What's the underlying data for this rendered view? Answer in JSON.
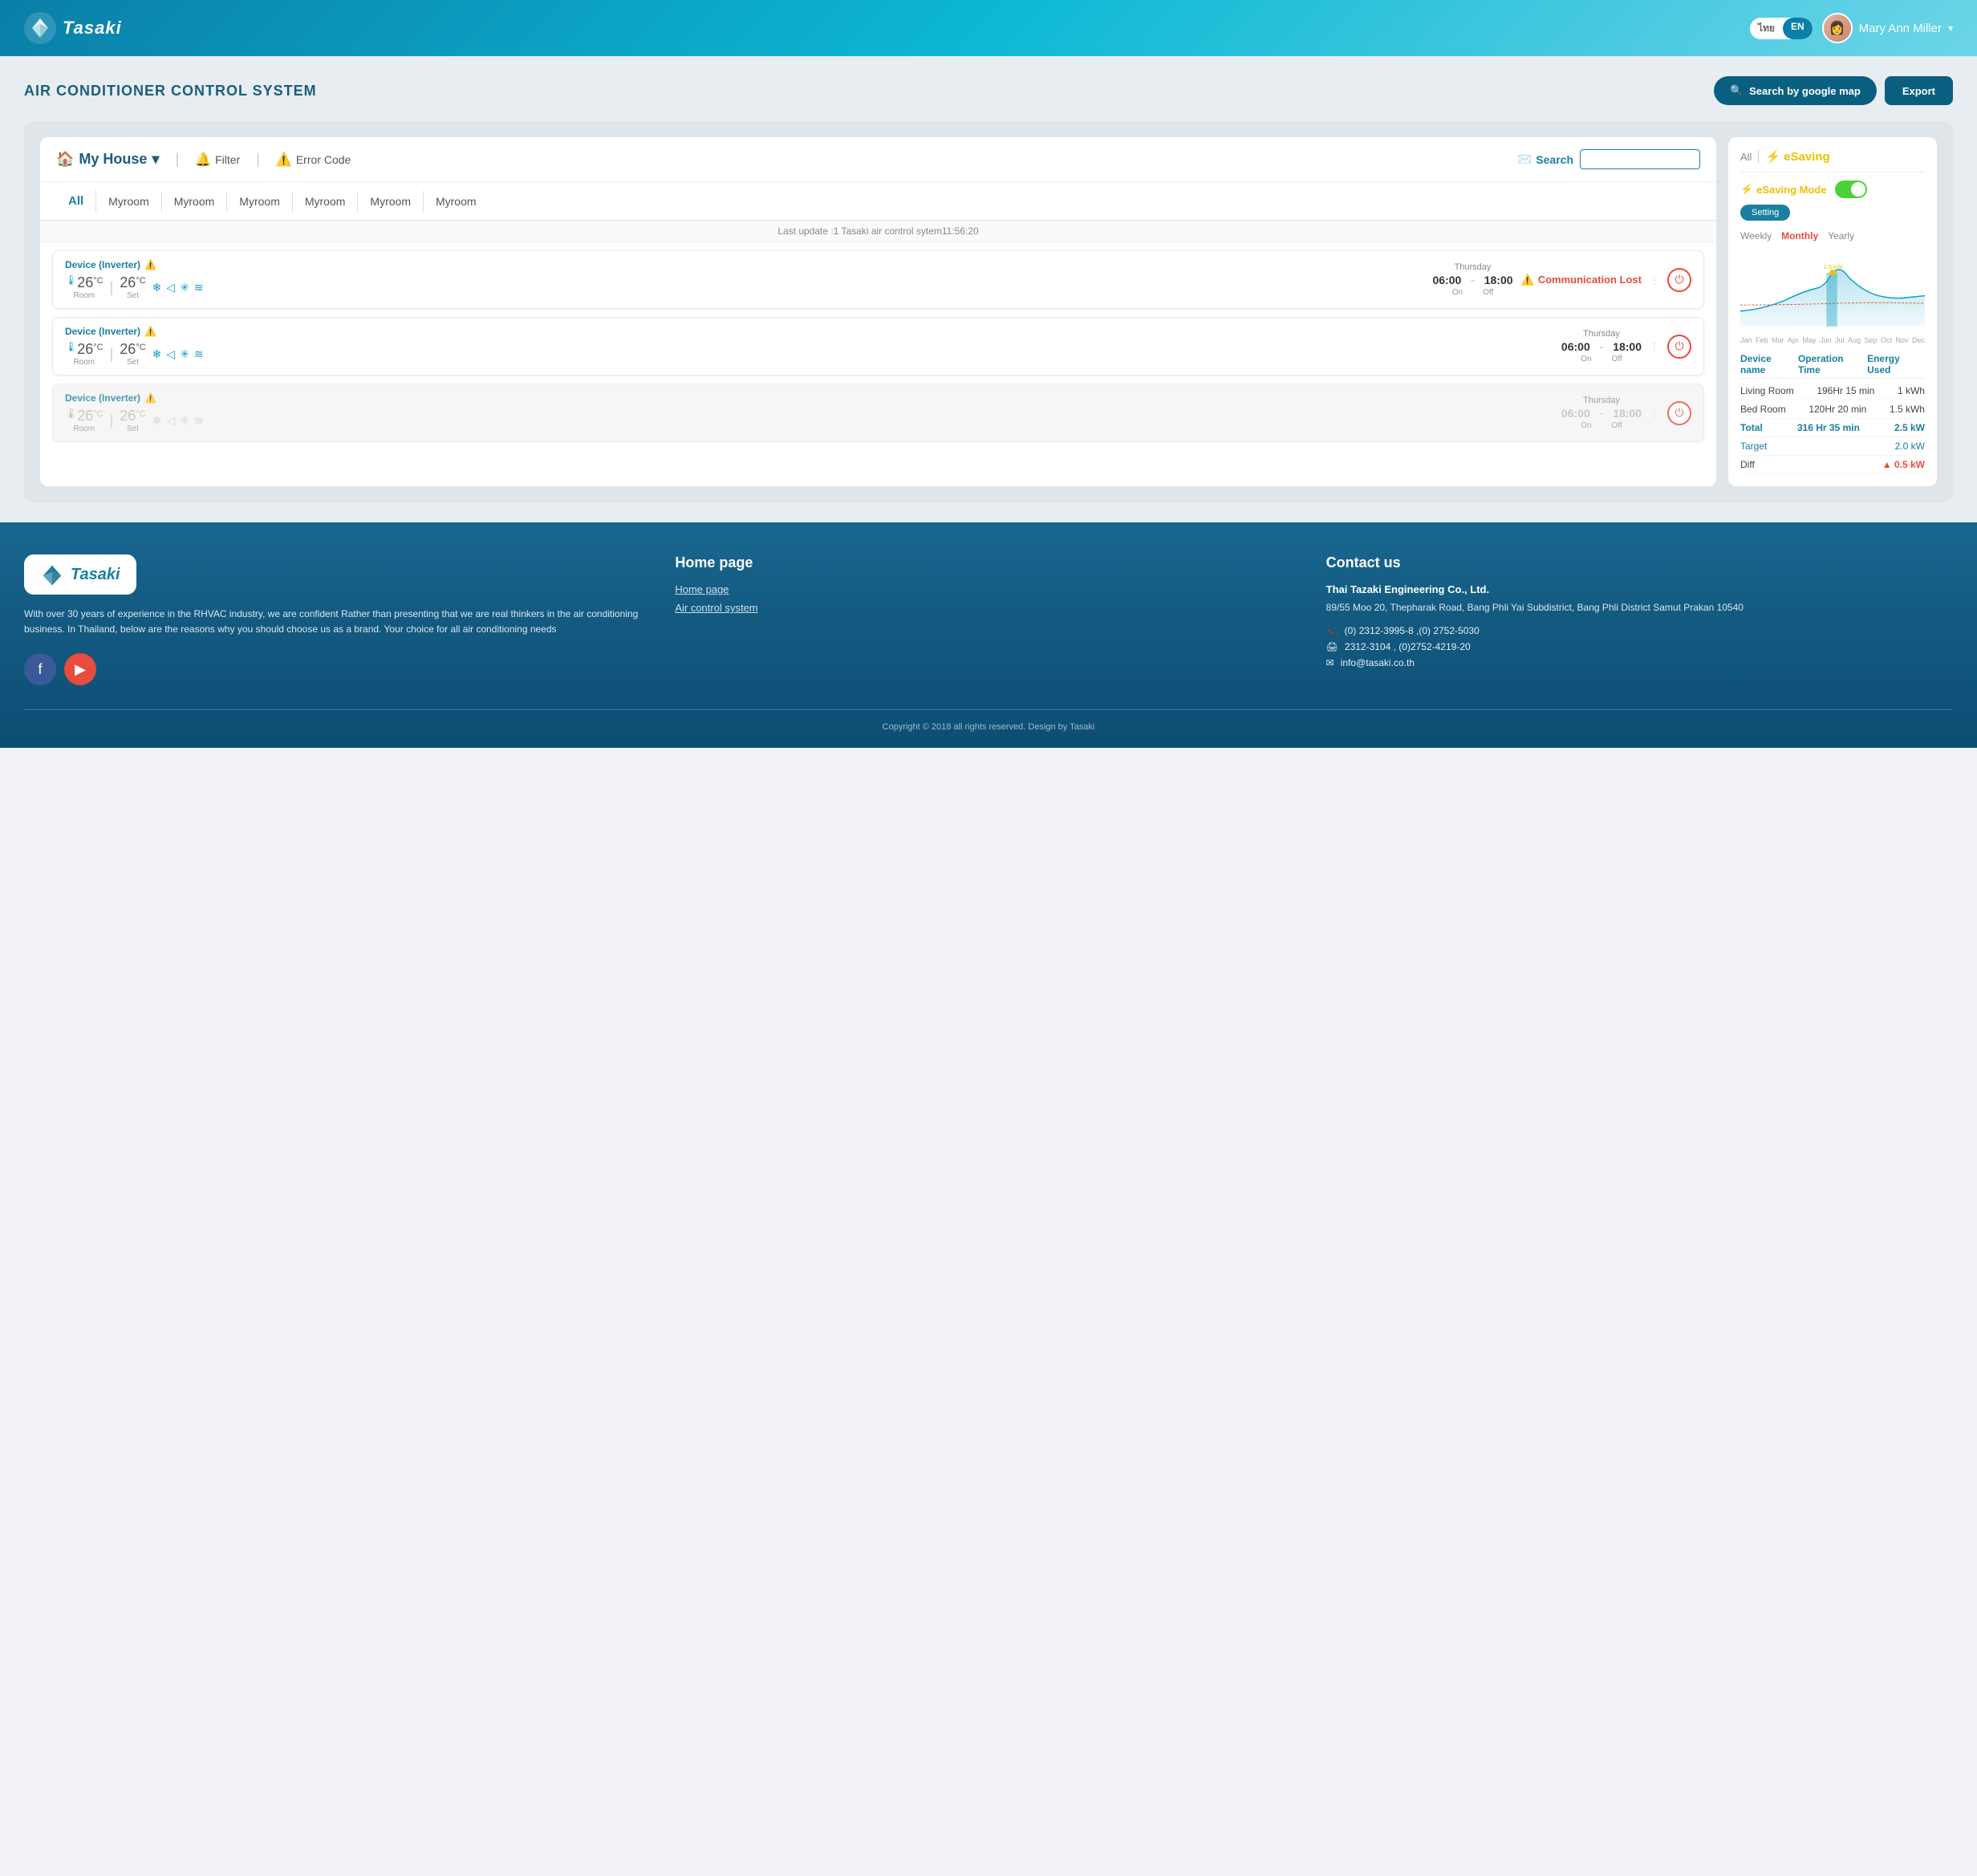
{
  "header": {
    "logo_text": "Tasaki",
    "lang_options": [
      "ไทย",
      "EN"
    ],
    "active_lang": "EN",
    "user_name": "Mary Ann Miller"
  },
  "page": {
    "title": "AIR CONDITIONER CONTROL SYSTEM",
    "btn_map_label": "Search by google map",
    "btn_export_label": "Export"
  },
  "control": {
    "house_name": "My House",
    "filter_label": "Filter",
    "error_code_label": "Error Code",
    "search_label": "Search",
    "search_placeholder": "",
    "update_text": "Last update :1 Tasaki air control sytem11:56:20",
    "tabs": [
      "All",
      "Myroom",
      "Myroom",
      "Myroom",
      "Myroom",
      "Myroom",
      "Myroom"
    ]
  },
  "devices": [
    {
      "type": "Device  (Inverter)",
      "room_temp": "26",
      "set_temp": "26",
      "day": "Thursday",
      "time_on": "06:00",
      "time_off": "18:00",
      "status": "comm_lost",
      "status_text": "Communication Lost"
    },
    {
      "type": "Device  (Inverter)",
      "room_temp": "26",
      "set_temp": "26",
      "day": "Thursday",
      "time_on": "06:00",
      "time_off": "18:00",
      "status": "normal",
      "status_text": ""
    },
    {
      "type": "Device  (Inverter)",
      "room_temp": "26",
      "set_temp": "26",
      "day": "Thursday",
      "time_on": "06:00",
      "time_off": "18:00",
      "status": "disabled",
      "status_text": ""
    }
  ],
  "esaving": {
    "all_label": "All",
    "title": "eSaving",
    "mode_label": "eSaving Mode",
    "setting_btn": "Setting",
    "periods": [
      "Weekly",
      "Monthly",
      "Yearly"
    ],
    "active_period": "Monthly",
    "months": [
      "Jan",
      "Feb",
      "Mar",
      "Apr",
      "May",
      "Jun",
      "Jul",
      "Aug",
      "Sep",
      "Oct",
      "Nov",
      "Dec"
    ],
    "table": {
      "headers": [
        "Device name",
        "Operation Time",
        "Energy Used"
      ],
      "rows": [
        {
          "name": "Living Room",
          "time": "196Hr 15 min",
          "energy": "1 kWh"
        },
        {
          "name": "Bed Room",
          "time": "120Hr 20 min",
          "energy": "1.5 kWh"
        }
      ],
      "total": {
        "label": "Total",
        "time": "316 Hr 35 min",
        "energy": "2.5 kW"
      },
      "target": {
        "label": "Target",
        "time": "",
        "energy": "2.0 kW"
      },
      "diff": {
        "label": "Diff",
        "time": "",
        "energy": "0.5 kW"
      }
    }
  },
  "footer": {
    "logo_text": "Tasaki",
    "description": "With over 30 years of experience in the RHVAC industry, we are confident Rather than presenting that we are real thinkers in the air conditioning business. In Thailand, below are the reasons why you should choose us as a brand. Your choice for all air conditioning needs",
    "nav_title": "Home page",
    "nav_links": [
      "Home page",
      "Air control system"
    ],
    "contact_title": "Contact us",
    "company": "Thai Tazaki Engineering Co., Ltd.",
    "address": "89/55 Moo 20, Thepharak Road,\nBang Phli Yai Subdistrict, Bang Phli District\nSamut Prakan 10540",
    "phone": "(0) 2312-3995-8 ,(0) 2752-5030",
    "fax": "2312-3104 , (0)2752-4219-20",
    "email": "info@tasaki.co.th",
    "copyright": "Copyright © 2018 all rights reserved. Design by Tasaki"
  }
}
